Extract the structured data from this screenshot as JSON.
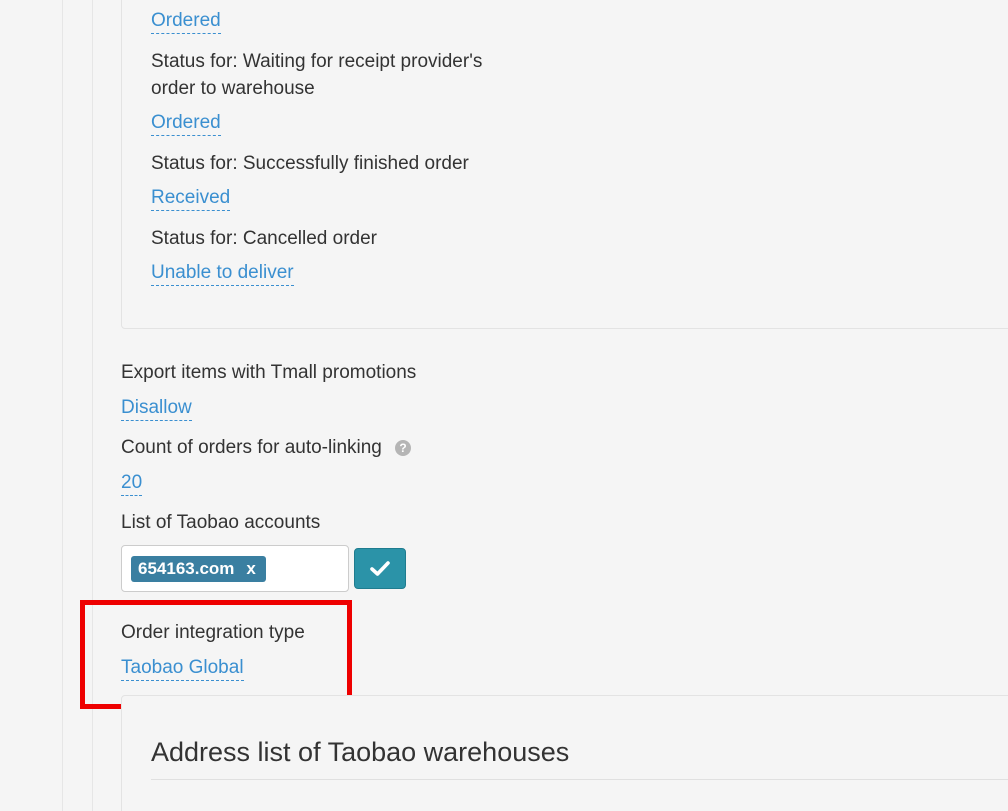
{
  "order_statuses": [
    {
      "label": "",
      "value": "Ordered"
    },
    {
      "label": "Status for: Waiting for receipt provider's\norder to warehouse",
      "value": "Ordered"
    },
    {
      "label": "Status for: Successfully finished order",
      "value": "Received"
    },
    {
      "label": "Status for: Cancelled order",
      "value": "Unable to deliver"
    }
  ],
  "settings": {
    "tmall_promotions": {
      "label": "Export items with Tmall promotions",
      "value": "Disallow"
    },
    "auto_linking": {
      "label": "Count of orders for auto-linking",
      "value": "20",
      "help_icon": "question-circle-icon",
      "help_glyph": "?"
    },
    "taobao_accounts": {
      "label": "List of Taobao accounts",
      "tags": [
        {
          "text": "654163.com",
          "remove": "x"
        }
      ],
      "confirm_icon": "check-icon"
    },
    "integration_type": {
      "label": "Order integration type",
      "value": "Taobao Global"
    }
  },
  "warehouse_section": {
    "title": "Address list of Taobao warehouses"
  },
  "colors": {
    "link": "#3a8fd0",
    "tag_bg": "#3a7fa1",
    "confirm_button": "#2b93a8",
    "highlight": "#ee0000",
    "background": "#f5f5f5"
  }
}
